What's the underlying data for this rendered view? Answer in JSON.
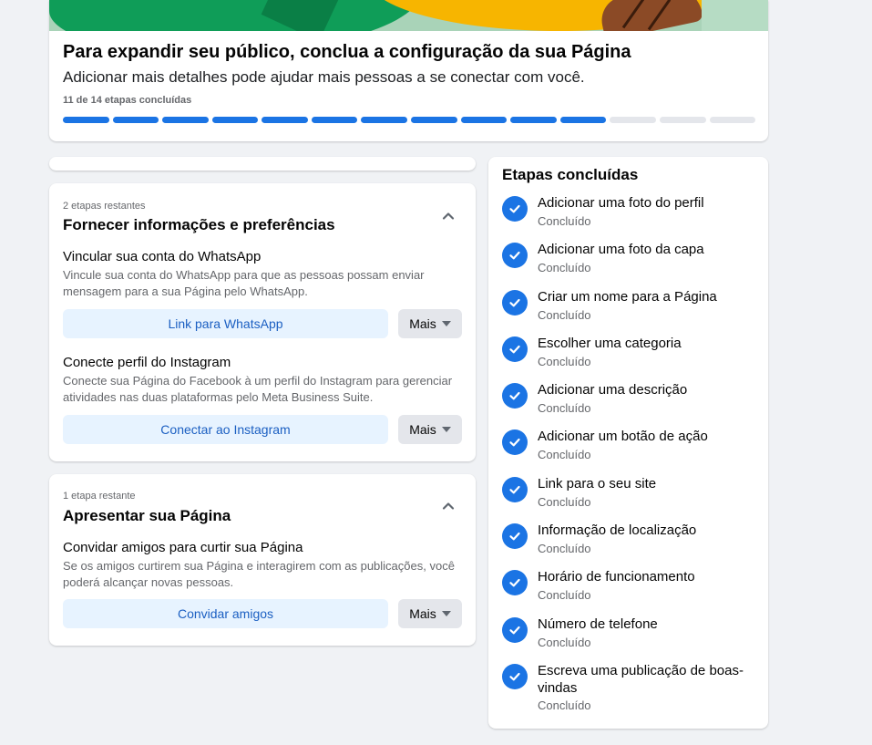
{
  "header": {
    "title": "Para expandir seu público, conclua a configuração da sua Página",
    "subtitle": "Adicionar mais detalhes pode ajudar mais pessoas a se conectar com você.",
    "steps_text": "11 de 14 etapas concluídas",
    "progress": {
      "completed": 11,
      "total": 14
    }
  },
  "info_section": {
    "remaining": "2 etapas restantes",
    "title": "Fornecer informações e preferências",
    "items": [
      {
        "title": "Vincular sua conta do WhatsApp",
        "description": "Vincule sua conta do WhatsApp para que as pessoas possam enviar mensagem para a sua Página pelo WhatsApp.",
        "button": "Link para WhatsApp",
        "more": "Mais"
      },
      {
        "title": "Conecte perfil do Instagram",
        "description": "Conecte sua Página do Facebook à um perfil do Instagram para gerenciar atividades nas duas plataformas pelo Meta Business Suite.",
        "button": "Conectar ao Instagram",
        "more": "Mais"
      }
    ]
  },
  "page_section": {
    "remaining": "1 etapa restante",
    "title": "Apresentar sua Página",
    "items": [
      {
        "title": "Convidar amigos para curtir sua Página",
        "description": "Se os amigos curtirem sua Página e interagirem com as publicações, você poderá alcançar novas pessoas.",
        "button": "Convidar amigos",
        "more": "Mais"
      }
    ]
  },
  "completed": {
    "title": "Etapas concluídas",
    "items": [
      {
        "label": "Adicionar uma foto do perfil",
        "status": "Concluído"
      },
      {
        "label": "Adicionar uma foto da capa",
        "status": "Concluído"
      },
      {
        "label": "Criar um nome para a Página",
        "status": "Concluído"
      },
      {
        "label": "Escolher uma categoria",
        "status": "Concluído"
      },
      {
        "label": "Adicionar uma descrição",
        "status": "Concluído"
      },
      {
        "label": "Adicionar um botão de ação",
        "status": "Concluído"
      },
      {
        "label": "Link para o seu site",
        "status": "Concluído"
      },
      {
        "label": "Informação de localização",
        "status": "Concluído"
      },
      {
        "label": "Horário de funcionamento",
        "status": "Concluído"
      },
      {
        "label": "Número de telefone",
        "status": "Concluído"
      },
      {
        "label": "Escreva uma publicação de boas-vindas",
        "status": "Concluído"
      }
    ]
  },
  "colors": {
    "accent": "#1b74e4",
    "button_bg": "#e7f3ff",
    "button_text": "#1b5fc2",
    "page_bg": "#f0f2f5"
  },
  "icons": [
    "chevron-up-icon",
    "caret-down-icon",
    "check-circle-icon"
  ]
}
